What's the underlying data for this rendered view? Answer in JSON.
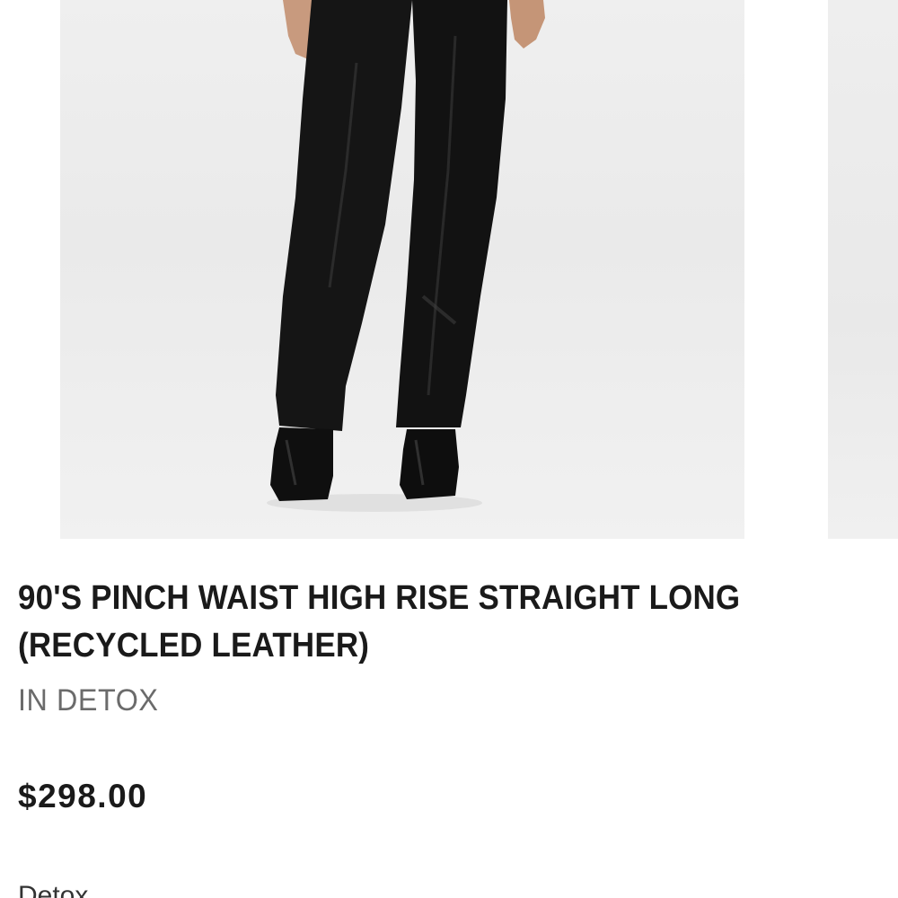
{
  "product": {
    "title": "90'S PINCH WAIST HIGH RISE STRAIGHT LONG (RECYCLED LEATHER)",
    "color": "IN DETOX",
    "price": "$298.00",
    "color_swatch_label": "Detox"
  },
  "gallery": {
    "main_image_alt": "model wearing black recycled leather straight-leg pants with black square-toe boots",
    "next_image_alt": "next product image"
  },
  "colors": {
    "title_text": "#1a1a1a",
    "subtitle_text": "#6b6b6b",
    "image_background": "#ececec",
    "garment": "#141414"
  }
}
